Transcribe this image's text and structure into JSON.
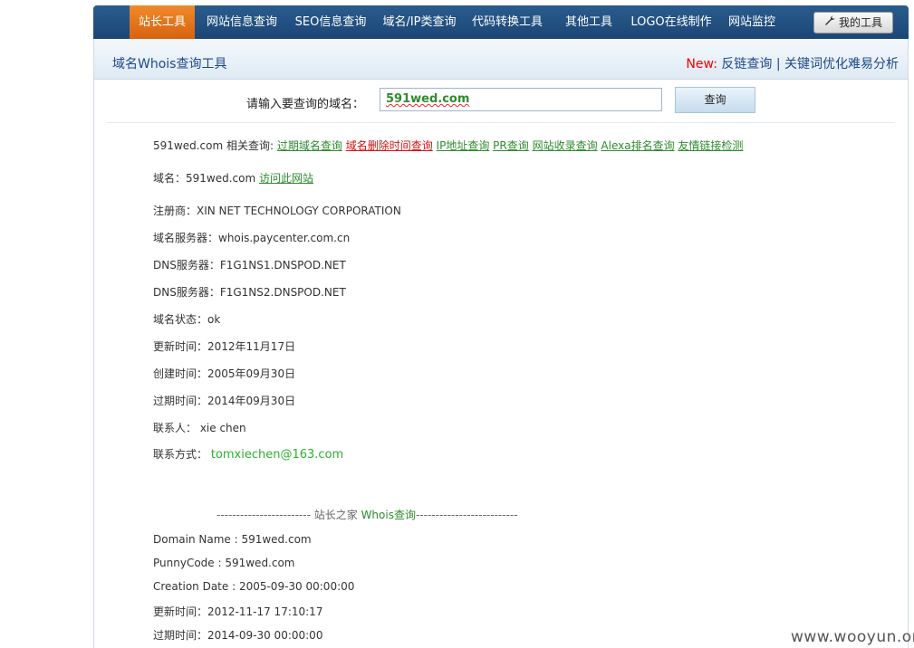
{
  "nav": {
    "items": [
      "站长工具",
      "网站信息查询",
      "SEO信息查询",
      "域名/IP类查询",
      "代码转换工具",
      "其他工具",
      "LOGO在线制作",
      "网站监控"
    ],
    "my_tools": "我的工具"
  },
  "header": {
    "title": "域名Whois查询工具",
    "new_label": "New:",
    "link1": "反链查询",
    "sep": "|",
    "link2": "关键词优化难易分析"
  },
  "search": {
    "label": "请输入要查询的域名：",
    "value": "591wed.com",
    "button": "查询"
  },
  "related": {
    "prefix": "591wed.com 相关查询:",
    "links": [
      "过期域名查询",
      "域名删除时间查询",
      "IP地址查询",
      "PR查询",
      "网站收录查询",
      "Alexa排名查询",
      "友情链接检测"
    ]
  },
  "domain_row": {
    "label": "域名：591wed.com",
    "link": "访问此网站"
  },
  "info": [
    "注册商：XIN NET TECHNOLOGY CORPORATION",
    "域名服务器：whois.paycenter.com.cn",
    "DNS服务器：F1G1NS1.DNSPOD.NET",
    "DNS服务器：F1G1NS2.DNSPOD.NET",
    "域名状态：ok",
    "更新时间：2012年11月17日",
    "创建时间：2005年09月30日",
    "过期时间：2014年09月30日",
    "联系人： xie chen"
  ],
  "contact": {
    "label": "联系方式：",
    "email": "tomxiechen@163.com"
  },
  "divider": {
    "left": "------------------------ 站长之家 ",
    "green": "Whois查询",
    "right": "--------------------------"
  },
  "raw": [
    "Domain Name : 591wed.com",
    "PunnyCode : 591wed.com",
    "Creation Date : 2005-09-30 00:00:00",
    "更新时间：2012-11-17 17:10:17",
    "过期时间：2014-09-30 00:00:00"
  ],
  "watermark": "www.wooyun.org",
  "colors": {
    "nav_bg": "#1b4675",
    "nav_active": "#e8761c",
    "link_green": "#2e8b2e",
    "link_red": "#d01414",
    "title_blue": "#1b4a88"
  }
}
